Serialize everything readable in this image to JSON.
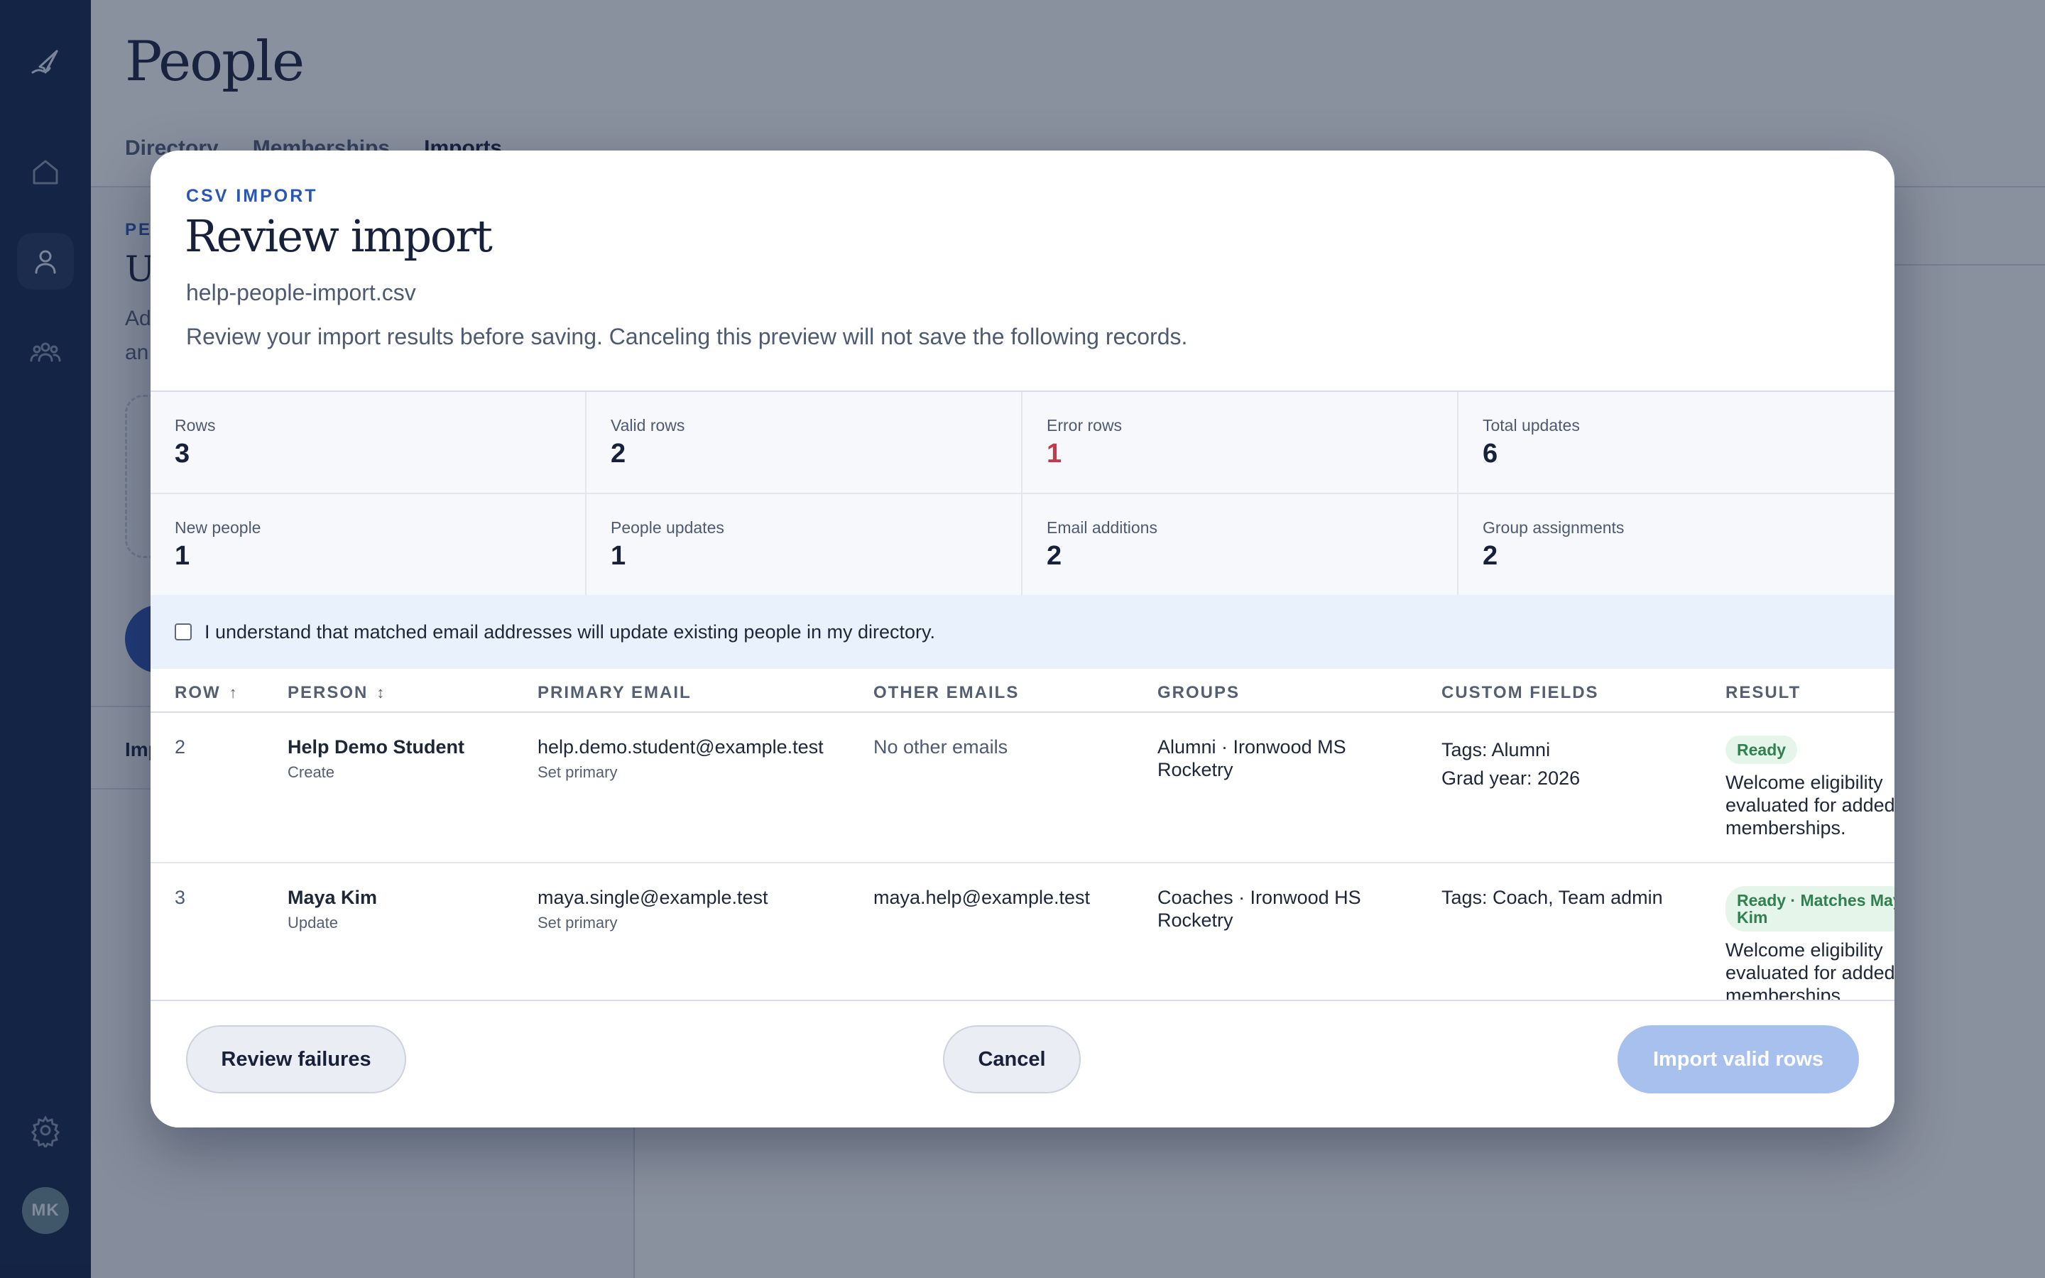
{
  "app": {
    "page_title": "People",
    "avatar_initials": "MK",
    "tabs": [
      {
        "label": "Directory"
      },
      {
        "label": "Memberships"
      },
      {
        "label": "Imports"
      }
    ],
    "background": {
      "kicker": "PE",
      "heading": "U",
      "text_line1": "Ad",
      "text_line2": "an",
      "list_item": "Imp"
    }
  },
  "modal": {
    "kicker": "CSV IMPORT",
    "title": "Review import",
    "filename": "help-people-import.csv",
    "description": "Review your import results before saving. Canceling this preview will not save the following records.",
    "stats": [
      {
        "label": "Rows",
        "value": "3"
      },
      {
        "label": "Valid rows",
        "value": "2"
      },
      {
        "label": "Error rows",
        "value": "1"
      },
      {
        "label": "Total updates",
        "value": "6"
      },
      {
        "label": "New people",
        "value": "1"
      },
      {
        "label": "People updates",
        "value": "1"
      },
      {
        "label": "Email additions",
        "value": "2"
      },
      {
        "label": "Group assignments",
        "value": "2"
      }
    ],
    "acknowledgement": "I understand that matched email addresses will update existing people in my directory.",
    "table": {
      "headers": {
        "row": "ROW",
        "person": "PERSON",
        "primary_email": "PRIMARY EMAIL",
        "other_emails": "OTHER EMAILS",
        "groups": "GROUPS",
        "custom_fields": "CUSTOM FIELDS",
        "result": "RESULT"
      },
      "rows": [
        {
          "row": "2",
          "person": "Help Demo Student",
          "action": "Create",
          "primary_email": "help.demo.student@example.test",
          "primary_note": "Set primary",
          "other_emails": "No other emails",
          "groups_line1": "Alumni · Ironwood MS",
          "groups_line2": "Rocketry",
          "custom_line1": "Tags: Alumni",
          "custom_line2": "Grad year: 2026",
          "badge": "Ready",
          "result_line1": "Welcome eligibility",
          "result_line2": "evaluated for added",
          "result_line3": "memberships."
        },
        {
          "row": "3",
          "person": "Maya Kim",
          "action": "Update",
          "primary_email": "maya.single@example.test",
          "primary_note": "Set primary",
          "other_emails": "maya.help@example.test",
          "groups_line1": "Coaches · Ironwood HS",
          "groups_line2": "Rocketry",
          "custom_line1": "Tags: Coach, Team admin",
          "badge_line1": "Ready · Matches Maya",
          "badge_line2": "Kim",
          "result_line1": "Welcome eligibility",
          "result_line2": "evaluated for added",
          "result_line3": "memberships."
        }
      ]
    },
    "footer": {
      "review_failures": "Review failures",
      "cancel": "Cancel",
      "import_valid": "Import valid rows"
    }
  }
}
